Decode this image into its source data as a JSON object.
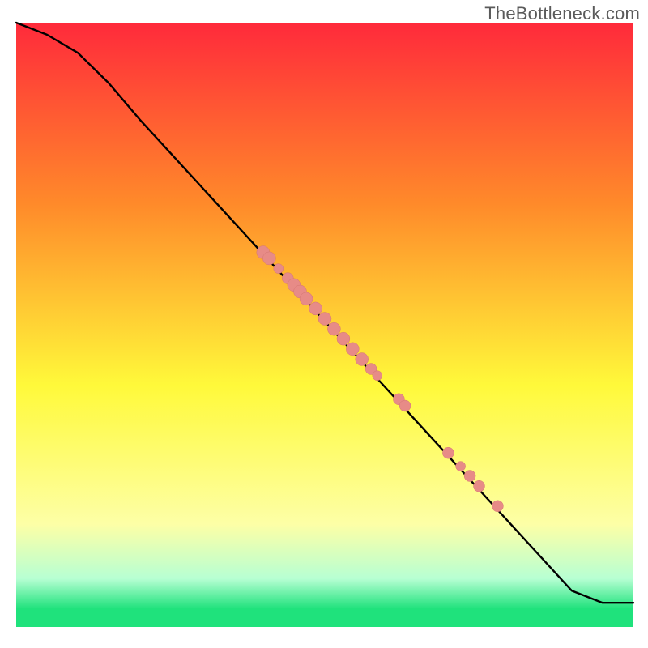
{
  "watermark": "TheBottleneck.com",
  "colors": {
    "red": "#ff2a3b",
    "orange": "#ff8a2a",
    "yellow": "#fff93a",
    "pale": "#fdffa6",
    "softgreen": "#b7ffd3",
    "green": "#1fe27c",
    "line": "#000000",
    "marker": "#e78b87",
    "marker_stroke": "#d57673"
  },
  "chart_data": {
    "type": "line",
    "title": "",
    "xlabel": "",
    "ylabel": "",
    "xlim": [
      0,
      100
    ],
    "ylim": [
      0,
      100
    ],
    "line": {
      "x": [
        0,
        5,
        10,
        15,
        20,
        90,
        95,
        100
      ],
      "y": [
        100,
        98,
        95,
        90,
        84,
        6,
        4,
        4
      ]
    },
    "markers": [
      {
        "x": 40,
        "y": 62,
        "r": 8
      },
      {
        "x": 41,
        "y": 61,
        "r": 8
      },
      {
        "x": 42.5,
        "y": 59.3,
        "r": 6
      },
      {
        "x": 44,
        "y": 57.7,
        "r": 7
      },
      {
        "x": 45,
        "y": 56.6,
        "r": 8
      },
      {
        "x": 46,
        "y": 55.5,
        "r": 8
      },
      {
        "x": 47,
        "y": 54.3,
        "r": 8
      },
      {
        "x": 48.5,
        "y": 52.7,
        "r": 8
      },
      {
        "x": 50,
        "y": 51,
        "r": 8
      },
      {
        "x": 51.5,
        "y": 49.3,
        "r": 8
      },
      {
        "x": 53,
        "y": 47.7,
        "r": 8
      },
      {
        "x": 54.5,
        "y": 46,
        "r": 8
      },
      {
        "x": 56,
        "y": 44.3,
        "r": 8
      },
      {
        "x": 57.5,
        "y": 42.7,
        "r": 7
      },
      {
        "x": 58.5,
        "y": 41.6,
        "r": 6
      },
      {
        "x": 62,
        "y": 37.7,
        "r": 7
      },
      {
        "x": 63,
        "y": 36.6,
        "r": 7
      },
      {
        "x": 70,
        "y": 28.8,
        "r": 7
      },
      {
        "x": 72,
        "y": 26.6,
        "r": 6
      },
      {
        "x": 73.5,
        "y": 25,
        "r": 7
      },
      {
        "x": 75,
        "y": 23.3,
        "r": 7
      },
      {
        "x": 78,
        "y": 20,
        "r": 7
      }
    ]
  }
}
